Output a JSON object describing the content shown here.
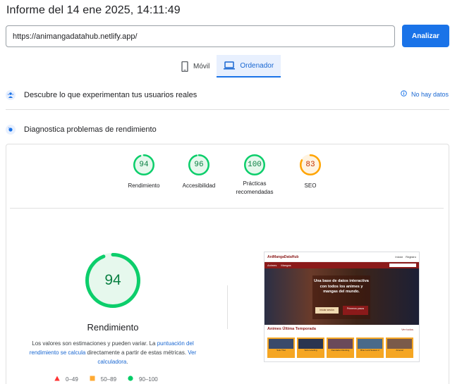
{
  "report": {
    "title": "Informe del 14 ene 2025, 14:11:49"
  },
  "search": {
    "url_value": "https://animangadatahub.netlify.app/",
    "analyze_label": "Analizar"
  },
  "tabs": [
    {
      "label": "Móvil",
      "icon": "mobile-icon",
      "active": false
    },
    {
      "label": "Ordenador",
      "icon": "laptop-icon",
      "active": true
    }
  ],
  "field_data": {
    "label": "Descubre lo que experimentan tus usuarios reales",
    "status": "No hay datos"
  },
  "diagnostics": {
    "label": "Diagnostica problemas de rendimiento"
  },
  "colors": {
    "pass": "#0cce6b",
    "average": "#ffa400",
    "fail": "#ff4e42",
    "accent": "#1a73e8"
  },
  "scores": [
    {
      "value": "94",
      "label": "Rendimiento",
      "score": 94,
      "color": "#0cce6b",
      "text_color": "#0a8043"
    },
    {
      "value": "96",
      "label": "Accesibilidad",
      "score": 96,
      "color": "#0cce6b",
      "text_color": "#0a8043"
    },
    {
      "value": "100",
      "label": "Prácticas recomendadas",
      "score": 100,
      "color": "#0cce6b",
      "text_color": "#0a8043"
    },
    {
      "value": "83",
      "label": "SEO",
      "score": 83,
      "color": "#ffa400",
      "text_color": "#c33300"
    }
  ],
  "main_score": {
    "value": "94",
    "score": 94,
    "label": "Rendimiento",
    "desc_prefix": "Los valores son estimaciones y pueden variar. La ",
    "desc_link1": "puntuación del rendimiento se calcula",
    "desc_middle": " directamente a partir de estas métricas. ",
    "desc_link2": "Ver calculadora",
    "desc_suffix": "."
  },
  "legend": [
    {
      "range": "0–49",
      "shape": "triangle"
    },
    {
      "range": "50–89",
      "shape": "square"
    },
    {
      "range": "90–100",
      "shape": "circle"
    }
  ],
  "thumbnail": {
    "logo": "AniMangaDataHub",
    "login": "Iniciar",
    "register": "Registro",
    "nav": [
      "Animes",
      "Mangas"
    ],
    "hero_text": "Una base de datos interactiva con todos los animes y mangas del mundo.",
    "btn_primary": "Iniciar sesión",
    "btn_secondary": "Primeros pasos",
    "section_title": "Animes Última Temporada",
    "more": "Ver todos",
    "cards": [
      "Solo Tbst",
      "Solo Leveling",
      "Dandadan Ranking",
      "Blue Lock Season 2",
      "Arsenal"
    ]
  }
}
